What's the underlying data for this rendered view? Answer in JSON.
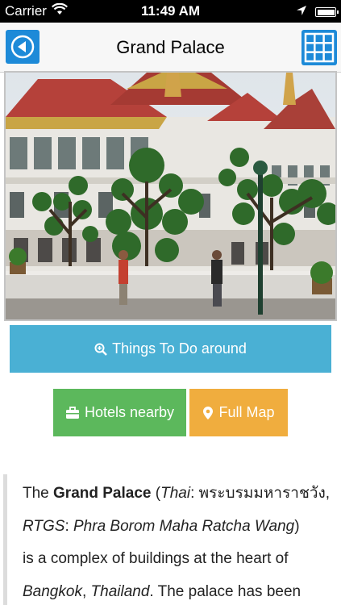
{
  "status_bar": {
    "carrier": "Carrier",
    "time": "11:49 AM"
  },
  "nav": {
    "title": "Grand Palace",
    "accent": "#1d8ad8"
  },
  "photo": {
    "subject": "Grand Palace building with topiary trees"
  },
  "actions": {
    "things_label": "Things To Do around",
    "hotels_label": "Hotels nearby",
    "map_label": "Full Map",
    "things_color": "#4ab0d4",
    "hotels_color": "#5cb85c",
    "map_color": "#f0ad3e"
  },
  "article": {
    "the": "The ",
    "name": "Grand Palace",
    "open_paren": " (",
    "thai_label": "Thai",
    "colon1": ": ",
    "thai_name": "พระบรมมหาราชวัง,",
    "rtgs_label": "RTGS",
    "colon2": ": ",
    "rtgs_name": "Phra Borom Maha Ratcha Wang",
    "close_paren": ")",
    "line3": "is a complex of buildings at the heart of",
    "city": "Bangkok",
    "comma": ", ",
    "country": "Thailand",
    "line4_rest": ". The palace has been"
  }
}
